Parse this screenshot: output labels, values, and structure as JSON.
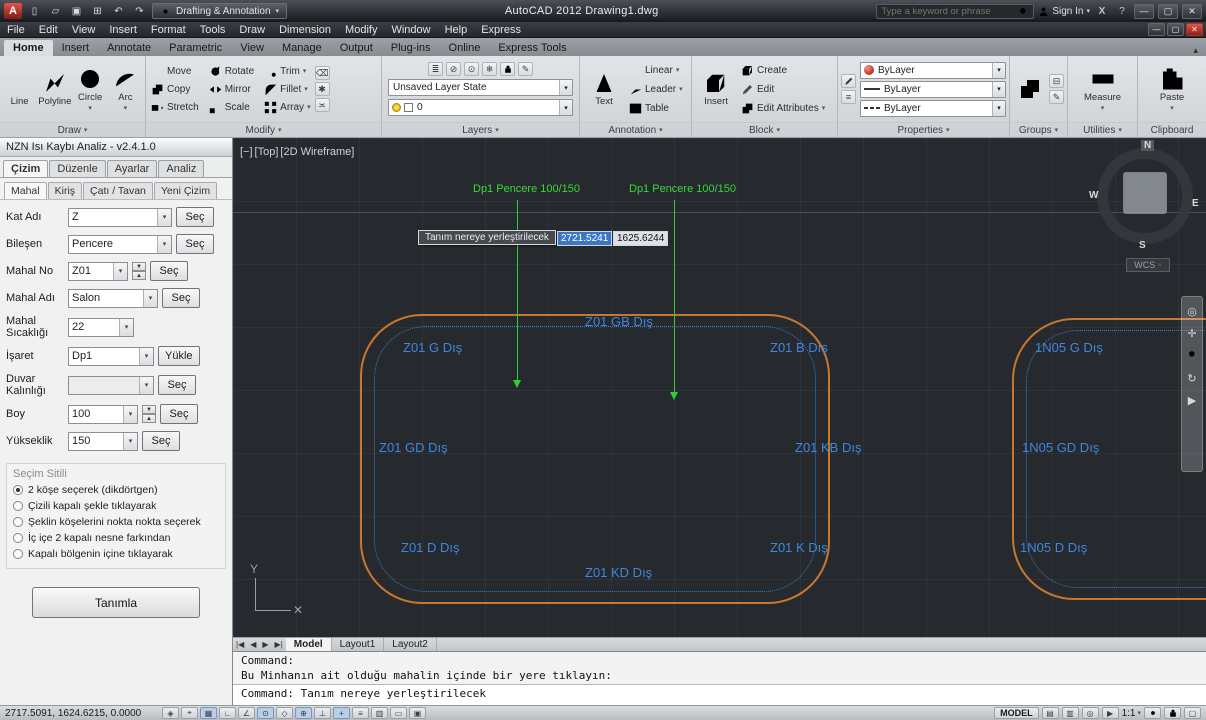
{
  "titlebar": {
    "app_initial": "A",
    "workspace": "Drafting & Annotation",
    "title": "AutoCAD 2012   Drawing1.dwg",
    "search_placeholder": "Type a keyword or phrase",
    "sign_in": "Sign In"
  },
  "menubar": {
    "items": [
      "File",
      "Edit",
      "View",
      "Insert",
      "Format",
      "Tools",
      "Draw",
      "Dimension",
      "Modify",
      "Window",
      "Help",
      "Express"
    ]
  },
  "ribbon": {
    "tabs": [
      "Home",
      "Insert",
      "Annotate",
      "Parametric",
      "View",
      "Manage",
      "Output",
      "Plug-ins",
      "Online",
      "Express Tools"
    ],
    "draw": {
      "label": "Draw",
      "tools": [
        "Line",
        "Polyline",
        "Circle",
        "Arc"
      ]
    },
    "modify": {
      "label": "Modify",
      "tools": [
        "Move",
        "Rotate",
        "Trim",
        "Copy",
        "Mirror",
        "Fillet",
        "Stretch",
        "Scale",
        "Array"
      ]
    },
    "layers": {
      "label": "Layers",
      "layer_state": "Unsaved Layer State",
      "current_layer": "0"
    },
    "annotation": {
      "label": "Annotation",
      "big": "Text",
      "tools": [
        "Linear",
        "Leader",
        "Table"
      ]
    },
    "block": {
      "label": "Block",
      "big": "Insert",
      "tools": [
        "Create",
        "Edit",
        "Edit Attributes"
      ]
    },
    "properties": {
      "label": "Properties",
      "rows": [
        "ByLayer",
        "ByLayer",
        "ByLayer"
      ]
    },
    "groups": {
      "label": "Groups"
    },
    "utilities": {
      "label": "Utilities",
      "big": "Measure"
    },
    "clipboard": {
      "label": "Clipboard",
      "big": "Paste"
    }
  },
  "palette": {
    "title": "NZN Isı Kaybı Analiz - v2.4.1.0",
    "tabs": [
      "Çizim",
      "Düzenle",
      "Ayarlar",
      "Analiz"
    ],
    "subtabs": [
      "Mahal",
      "Kiriş",
      "Çatı / Tavan",
      "Yeni Çizim"
    ],
    "fields": [
      {
        "label": "Kat Adı",
        "value": "Z",
        "button": "Seç"
      },
      {
        "label": "Bileşen",
        "value": "Pencere",
        "button": "Seç"
      },
      {
        "label": "Mahal No",
        "value": "Z01",
        "button": "Seç"
      },
      {
        "label": "Mahal Adı",
        "value": "Salon",
        "button": "Seç"
      },
      {
        "label": "Mahal Sıcaklığı",
        "value": "22",
        "button": ""
      },
      {
        "label": "İşaret",
        "value": "Dp1",
        "button": "Yükle"
      },
      {
        "label": "Duvar Kalınlığı",
        "value": "",
        "button": "Seç"
      },
      {
        "label": "Boy",
        "value": "100",
        "button": "Seç"
      },
      {
        "label": "Yükseklik",
        "value": "150",
        "button": "Seç"
      }
    ],
    "selection_group": {
      "title": "Seçim Sitili",
      "options": [
        "2 köşe seçerek (dikdörtgen)",
        "Çizili kapalı şekle tıklayarak",
        "Şeklin köşelerini nokta nokta seçerek",
        "İç içe 2 kapalı nesne farkından",
        "Kapalı bölgenin içine tıklayarak"
      ],
      "selected_index": 0
    },
    "action_button": "Tanımla"
  },
  "canvas": {
    "viewport": {
      "minimize": "[−]",
      "view": "[Top]",
      "visual_style": "[2D Wireframe]"
    },
    "window_labels": [
      "Dp1 Pencere 100/150",
      "Dp1 Pencere 100/150"
    ],
    "tooltip": "Tanım nereye yerleştirilecek",
    "dyn_input_x": "2721.5241",
    "dyn_input_y": "1625.6244",
    "room_labels": [
      "Z01 GB Dış",
      "Z01 G Dış",
      "Z01 B Dış",
      "Z01 GD Dış",
      "Z01 KB Dış",
      "Z01 D Dış",
      "Z01 KD Dış",
      "Z01 K Dış",
      "1N05 G Dış",
      "1N05 GD Dış",
      "1N05 D Dış"
    ],
    "compass": {
      "n": "N",
      "s": "S",
      "e": "E",
      "w": "W"
    },
    "wcs_label": "WCS",
    "ucs_axis_y": "Y"
  },
  "layout_tabs": {
    "items": [
      "Model",
      "Layout1",
      "Layout2"
    ],
    "active": "Model"
  },
  "command": {
    "history": [
      "Command:",
      "Bu Minhanın ait olduğu mahalin içinde bir yere tıklayın:"
    ],
    "prompt": "Command: Tanım nereye yerleştirilecek"
  },
  "statusbar": {
    "coordinates": "2717.5091, 1624.6215, 0.0000",
    "model_label": "MODEL",
    "annotation_scale": "1:1"
  }
}
